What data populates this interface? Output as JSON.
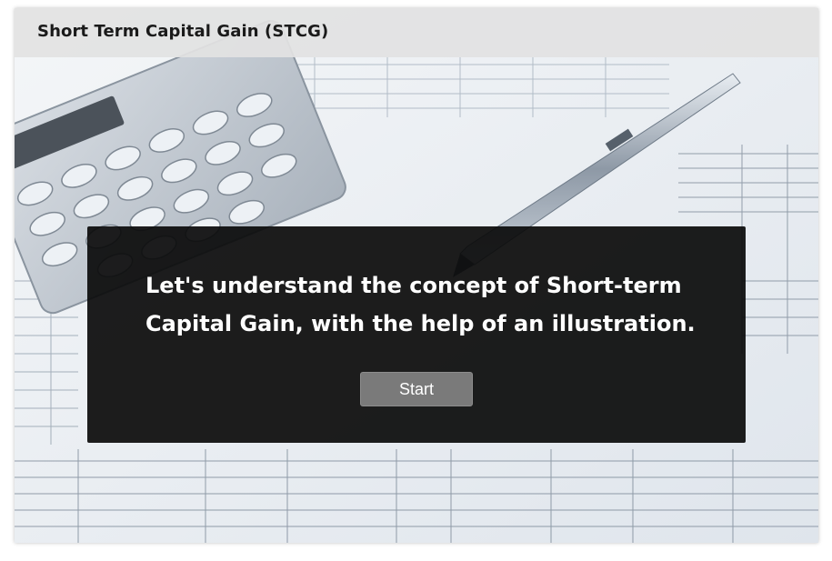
{
  "header": {
    "title": "Short Term Capital Gain (STCG)"
  },
  "intro": {
    "message": "Let's understand the concept of Short-term Capital Gain, with the help of an illustration.",
    "start_label": "Start"
  },
  "background": {
    "scene": "calculator-pen-financial-spreadsheets"
  },
  "colors": {
    "overlay": "#0a0a0a",
    "button": "#7a7a7a",
    "titlebar": "#e2e2e2"
  }
}
